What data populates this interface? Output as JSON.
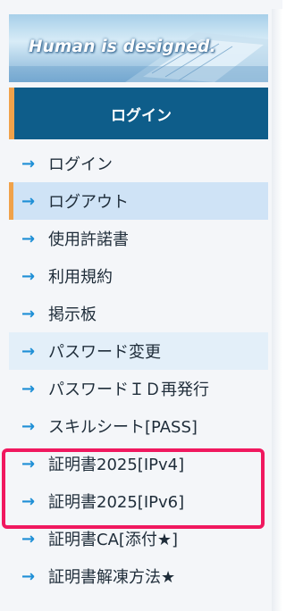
{
  "banner": {
    "text": "Human is designed."
  },
  "header": {
    "title": "ログイン"
  },
  "menu": {
    "items": [
      {
        "label": "ログイン"
      },
      {
        "label": "ログアウト"
      },
      {
        "label": "使用許諾書"
      },
      {
        "label": "利用規約"
      },
      {
        "label": "掲示板"
      },
      {
        "label": "パスワード変更"
      },
      {
        "label": "パスワードＩＤ再発行"
      },
      {
        "label": "スキルシート[PASS]"
      },
      {
        "label": "証明書2025[IPv4]"
      },
      {
        "label": "証明書2025[IPv6]"
      },
      {
        "label": "証明書CA[添付★]"
      },
      {
        "label": "証明書解凍方法★"
      }
    ],
    "arrow_glyph": "→"
  },
  "colors": {
    "header_bg": "#0e5d8a",
    "accent": "#f0a24a",
    "arrow": "#1e8fd6",
    "active_bg": "#cfe3f6",
    "highlight_border": "#f0185f"
  }
}
